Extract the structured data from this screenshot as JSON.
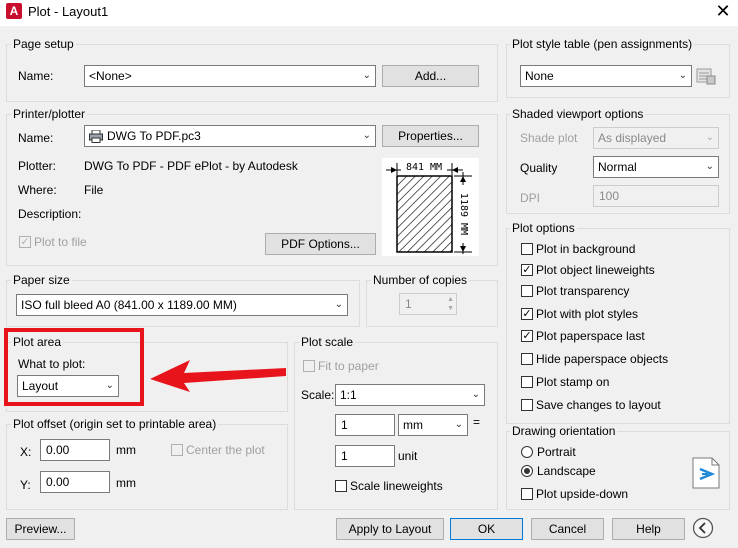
{
  "window": {
    "title": "Plot - Layout1",
    "app_icon_letter": "A"
  },
  "page_setup": {
    "group": "Page setup",
    "name_label": "Name:",
    "name_value": "<None>",
    "add_button": "Add..."
  },
  "printer": {
    "group": "Printer/plotter",
    "name_label": "Name:",
    "name_value": "DWG To PDF.pc3",
    "properties_button": "Properties...",
    "plotter_label": "Plotter:",
    "plotter_value": "DWG To PDF - PDF ePlot - by Autodesk",
    "where_label": "Where:",
    "where_value": "File",
    "description_label": "Description:",
    "plot_to_file": "Plot to file",
    "pdf_options_button": "PDF Options...",
    "preview_width": "841 MM",
    "preview_height": "1189 MM"
  },
  "paper_size": {
    "group": "Paper size",
    "value": "ISO full bleed A0 (841.00 x 1189.00 MM)"
  },
  "copies": {
    "group": "Number of copies",
    "value": "1"
  },
  "plot_area": {
    "group": "Plot area",
    "what_label": "What to plot:",
    "what_value": "Layout"
  },
  "plot_offset": {
    "group": "Plot offset (origin set to printable area)",
    "x_label": "X:",
    "x_value": "0.00",
    "x_unit": "mm",
    "y_label": "Y:",
    "y_value": "0.00",
    "y_unit": "mm",
    "center": "Center the plot"
  },
  "plot_scale": {
    "group": "Plot scale",
    "fit": "Fit to paper",
    "scale_label": "Scale:",
    "scale_value": "1:1",
    "num_value": "1",
    "unit_value": "mm",
    "equals": "=",
    "den_value": "1",
    "unit_label": "unit",
    "lineweights": "Scale lineweights"
  },
  "plot_style": {
    "group": "Plot style table (pen assignments)",
    "value": "None"
  },
  "shaded": {
    "group": "Shaded viewport options",
    "shade_label": "Shade plot",
    "shade_value": "As displayed",
    "quality_label": "Quality",
    "quality_value": "Normal",
    "dpi_label": "DPI",
    "dpi_value": "100"
  },
  "plot_options": {
    "group": "Plot options",
    "items": [
      {
        "label": "Plot in background",
        "checked": ""
      },
      {
        "label": "Plot object lineweights",
        "checked": "✓"
      },
      {
        "label": "Plot transparency",
        "checked": ""
      },
      {
        "label": "Plot with plot styles",
        "checked": "✓"
      },
      {
        "label": "Plot paperspace last",
        "checked": "✓"
      },
      {
        "label": "Hide paperspace objects",
        "checked": ""
      },
      {
        "label": "Plot stamp on",
        "checked": ""
      },
      {
        "label": "Save changes to layout",
        "checked": ""
      }
    ]
  },
  "orientation": {
    "group": "Drawing orientation",
    "portrait": "Portrait",
    "landscape": "Landscape",
    "upside_down": "Plot upside-down"
  },
  "footer": {
    "preview": "Preview...",
    "apply": "Apply to Layout",
    "ok": "OK",
    "cancel": "Cancel",
    "help": "Help"
  },
  "colors": {
    "highlight": "#e8141b",
    "accent": "#0078d7"
  }
}
